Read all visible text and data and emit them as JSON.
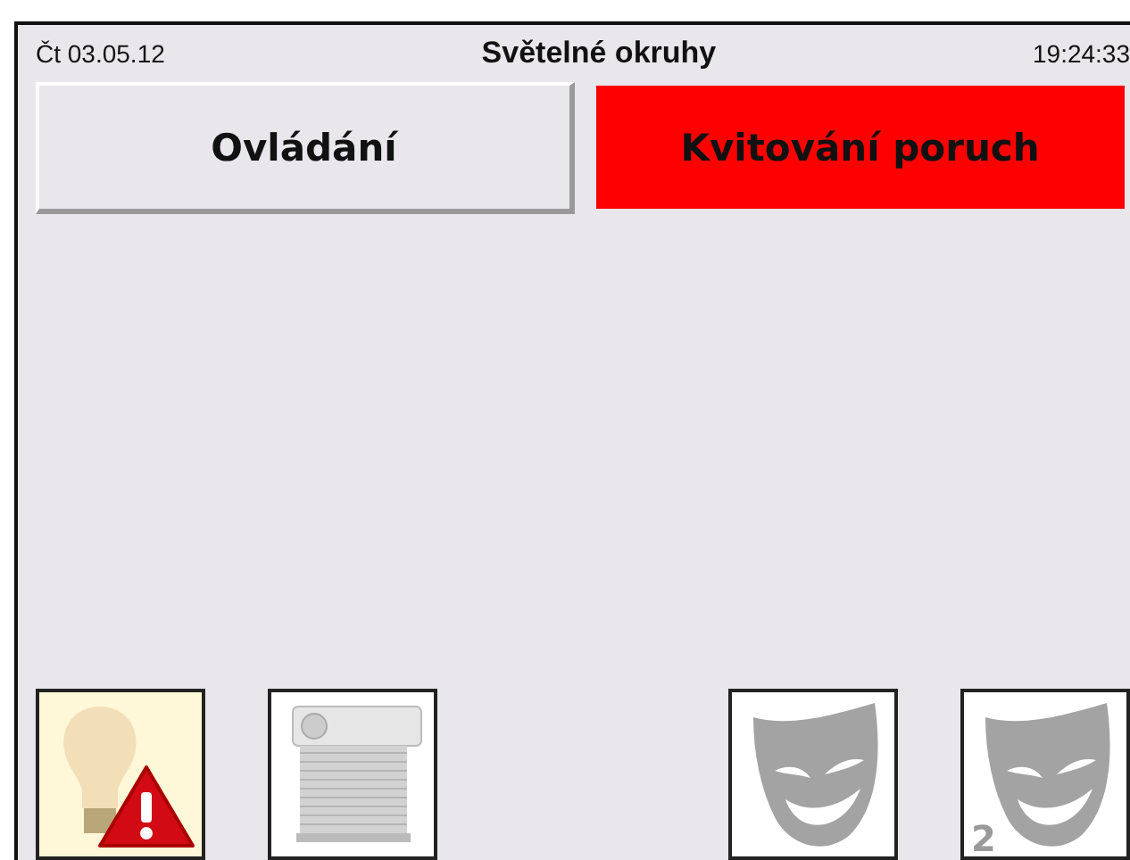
{
  "header": {
    "date": "Čt 03.05.12",
    "title": "Světelné okruhy",
    "time": "19:24:33"
  },
  "buttons": [
    {
      "label": "Ovládání",
      "alert": false
    },
    {
      "label": "Kvitování poruch",
      "alert": true
    }
  ],
  "tile_groups": [
    {
      "tiles": [
        {
          "kind": "bulb-alert"
        },
        {
          "kind": "shutter"
        }
      ]
    },
    {
      "tiles": [
        {
          "kind": "mask"
        },
        {
          "kind": "mask",
          "badge": "2"
        }
      ]
    }
  ]
}
